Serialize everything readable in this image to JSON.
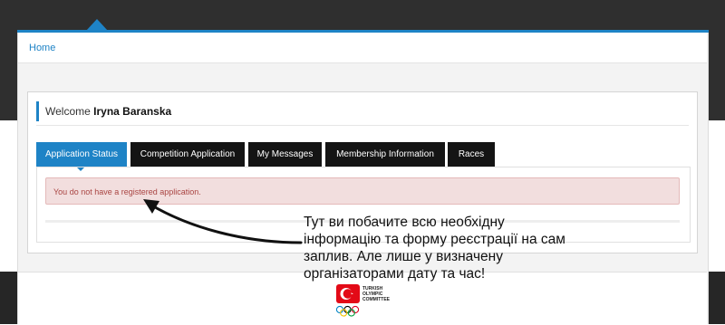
{
  "breadcrumb": {
    "home": "Home"
  },
  "welcome": {
    "prefix": "Welcome",
    "name": "Iryna Baranska"
  },
  "tabs": [
    {
      "label": "Application Status",
      "active": true
    },
    {
      "label": "Competition Application",
      "active": false
    },
    {
      "label": "My Messages",
      "active": false
    },
    {
      "label": "Membership Information",
      "active": false
    },
    {
      "label": "Races",
      "active": false
    }
  ],
  "alert": {
    "text": "You do not have a registered application."
  },
  "annotation": {
    "lines": [
      "Тут ви побачите всю необхідну",
      "інформацію та форму реєстрації на сам",
      "заплив. Але лише у визначену",
      "організаторами дату та час!"
    ]
  },
  "footer_logo": {
    "icon": "turkish-olympic-committee-logo",
    "text_lines": [
      "TURKISH",
      "OLYMPIC",
      "COMMITTEE"
    ]
  },
  "colors": {
    "accent": "#1e83c6",
    "tab_dark": "#141414",
    "alert_bg": "#f2dede",
    "alert_text": "#a94442",
    "flag_red": "#e30a17"
  }
}
